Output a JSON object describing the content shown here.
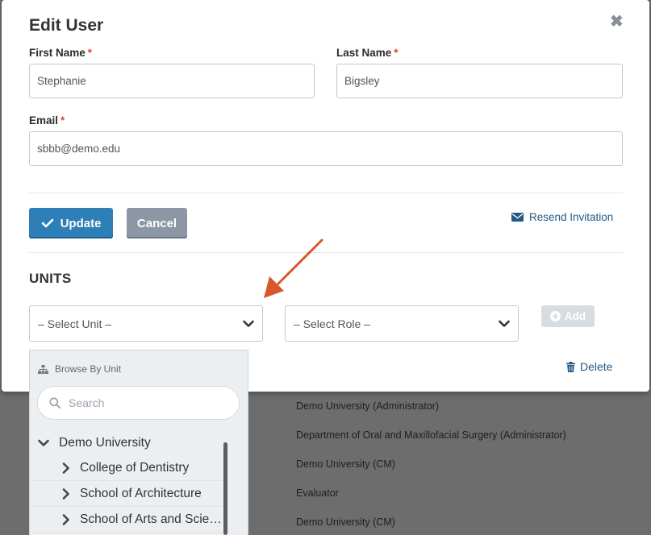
{
  "background_rows": [
    "Demo University (Administrator)",
    "Department of Oral and Maxillofacial Surgery (Administrator)",
    "Demo University (CM)",
    "Evaluator",
    "Demo University (CM)"
  ],
  "modal": {
    "title": "Edit User",
    "close_glyph": "✖",
    "first_name": {
      "label": "First Name",
      "value": "Stephanie",
      "required": "*"
    },
    "last_name": {
      "label": "Last Name",
      "value": "Bigsley",
      "required": "*"
    },
    "email": {
      "label": "Email",
      "value": "sbbb@demo.edu",
      "required": "*"
    },
    "update_label": "Update",
    "cancel_label": "Cancel",
    "resend_label": "Resend Invitation"
  },
  "units": {
    "heading": "UNITS",
    "unit_select": "– Select Unit –",
    "role_select": "– Select Role –",
    "add_label": "Add",
    "delete_label": "Delete"
  },
  "dropdown": {
    "browse_label": "Browse By Unit",
    "search_placeholder": "Search",
    "root": "Demo University",
    "children": [
      "College of Dentistry",
      "School of Architecture",
      "School of Arts and Scienc..."
    ]
  },
  "colors": {
    "primary": "#2e7fb7",
    "cancel": "#8c96a4",
    "link": "#245a87",
    "required": "#e0413a",
    "annotation_arrow": "#d9582b"
  }
}
